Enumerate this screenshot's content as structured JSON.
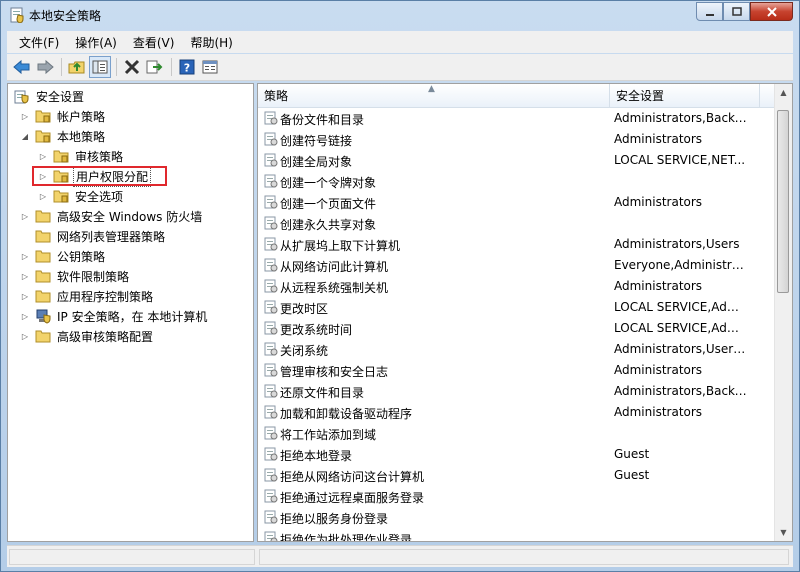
{
  "window": {
    "title": "本地安全策略"
  },
  "menu": [
    {
      "label": "文件(F)"
    },
    {
      "label": "操作(A)"
    },
    {
      "label": "查看(V)"
    },
    {
      "label": "帮助(H)"
    }
  ],
  "toolbar": [
    "back-icon",
    "forward-icon",
    "up-folder-icon",
    "show-tree-icon",
    "delete-icon",
    "export-icon",
    "help-icon",
    "properties-icon"
  ],
  "tree": [
    {
      "label": "安全设置",
      "level": 0,
      "expander": "",
      "icon": "security-settings-icon"
    },
    {
      "label": "帐户策略",
      "level": 1,
      "expander": "closed",
      "icon": "folder-icon"
    },
    {
      "label": "本地策略",
      "level": 1,
      "expander": "open",
      "icon": "folder-icon"
    },
    {
      "label": "审核策略",
      "level": 2,
      "expander": "closed",
      "icon": "folder-icon"
    },
    {
      "label": "用户权限分配",
      "level": 2,
      "expander": "closed",
      "icon": "folder-icon",
      "selected": true
    },
    {
      "label": "安全选项",
      "level": 2,
      "expander": "closed",
      "icon": "folder-icon"
    },
    {
      "label": "高级安全 Windows 防火墙",
      "level": 1,
      "expander": "closed",
      "icon": "folder-icon"
    },
    {
      "label": "网络列表管理器策略",
      "level": 1,
      "expander": "",
      "icon": "folder-icon"
    },
    {
      "label": "公钥策略",
      "level": 1,
      "expander": "closed",
      "icon": "folder-icon"
    },
    {
      "label": "软件限制策略",
      "level": 1,
      "expander": "closed",
      "icon": "folder-icon"
    },
    {
      "label": "应用程序控制策略",
      "level": 1,
      "expander": "closed",
      "icon": "folder-icon"
    },
    {
      "label": "IP 安全策略，在 本地计算机",
      "level": 1,
      "expander": "closed",
      "icon": "ip-security-icon"
    },
    {
      "label": "高级审核策略配置",
      "level": 1,
      "expander": "closed",
      "icon": "folder-icon"
    }
  ],
  "list": {
    "columns": {
      "policy": "策略",
      "setting": "安全设置"
    },
    "rows": [
      {
        "name": "备份文件和目录",
        "setting": "Administrators,Backu..."
      },
      {
        "name": "创建符号链接",
        "setting": "Administrators"
      },
      {
        "name": "创建全局对象",
        "setting": "LOCAL SERVICE,NET..."
      },
      {
        "name": "创建一个令牌对象",
        "setting": ""
      },
      {
        "name": "创建一个页面文件",
        "setting": "Administrators"
      },
      {
        "name": "创建永久共享对象",
        "setting": ""
      },
      {
        "name": "从扩展坞上取下计算机",
        "setting": "Administrators,Users"
      },
      {
        "name": "从网络访问此计算机",
        "setting": "Everyone,Administrat..."
      },
      {
        "name": "从远程系统强制关机",
        "setting": "Administrators"
      },
      {
        "name": "更改时区",
        "setting": "LOCAL SERVICE,Admi..."
      },
      {
        "name": "更改系统时间",
        "setting": "LOCAL SERVICE,Admi..."
      },
      {
        "name": "关闭系统",
        "setting": "Administrators,Users,..."
      },
      {
        "name": "管理审核和安全日志",
        "setting": "Administrators"
      },
      {
        "name": "还原文件和目录",
        "setting": "Administrators,Backu..."
      },
      {
        "name": "加载和卸载设备驱动程序",
        "setting": "Administrators"
      },
      {
        "name": "将工作站添加到域",
        "setting": ""
      },
      {
        "name": "拒绝本地登录",
        "setting": "Guest"
      },
      {
        "name": "拒绝从网络访问这台计算机",
        "setting": "Guest"
      },
      {
        "name": "拒绝通过远程桌面服务登录",
        "setting": ""
      },
      {
        "name": "拒绝以服务身份登录",
        "setting": ""
      },
      {
        "name": "拒绝作为批处理作业登录",
        "setting": ""
      }
    ]
  },
  "colors": {
    "selection_box": "#e0282d",
    "header_bg": "#eaf1f9"
  }
}
